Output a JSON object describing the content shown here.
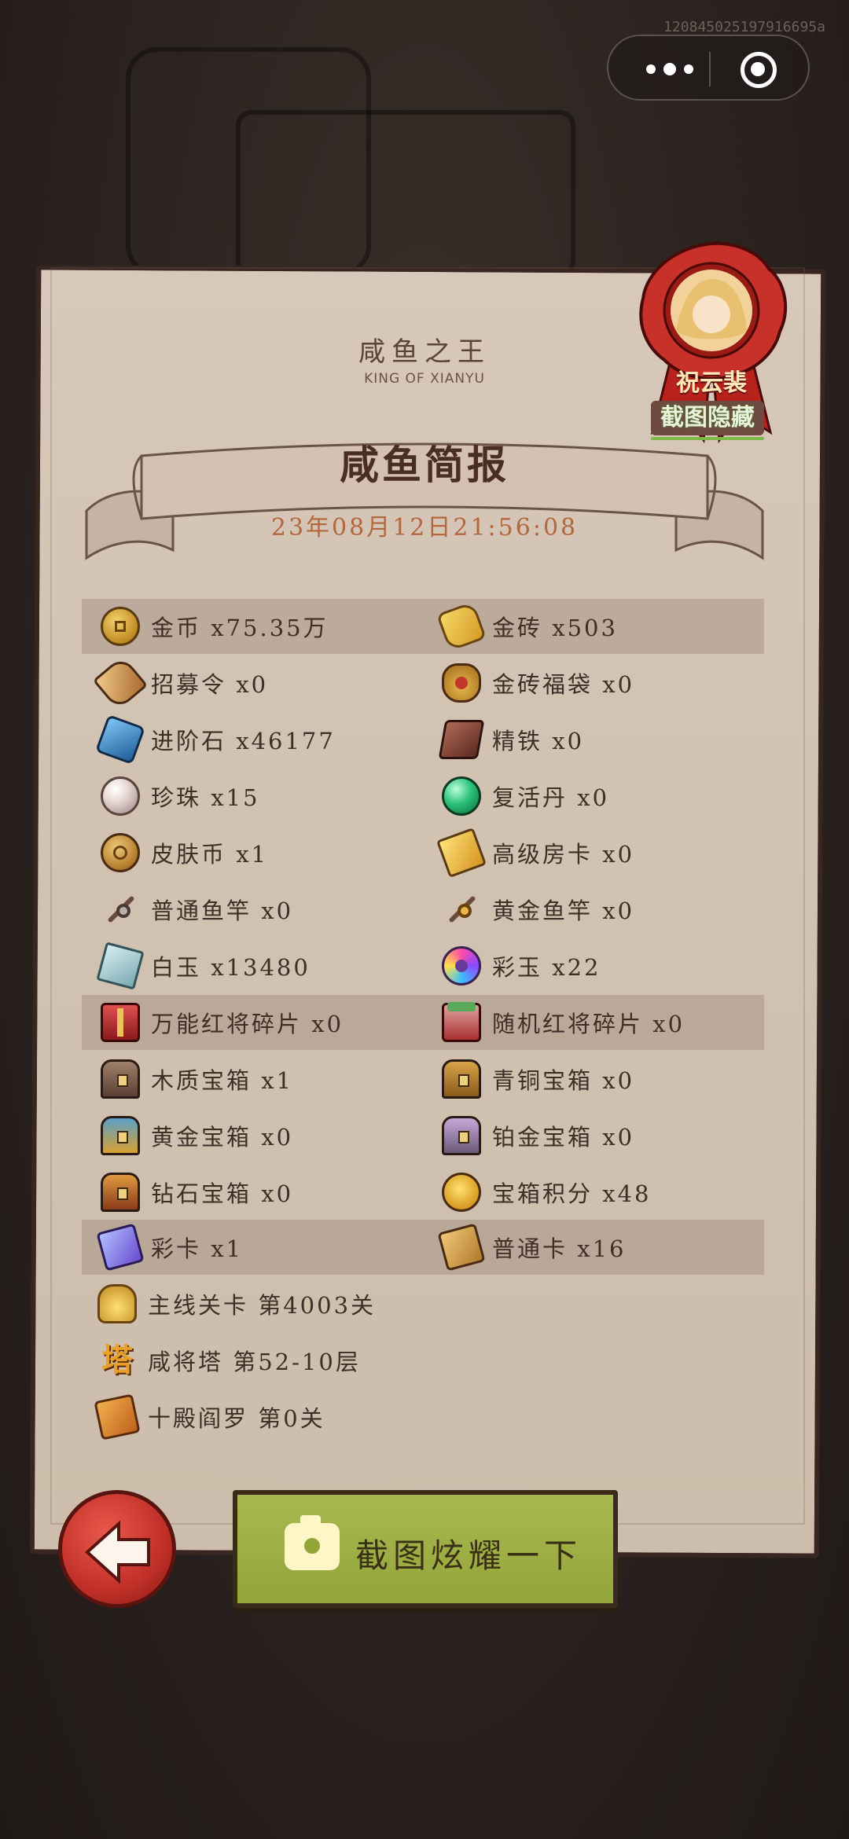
{
  "device_id": "120845025197916695a",
  "header": {
    "title_cn": "咸鱼之王",
    "title_en": "KING OF XIANYU"
  },
  "report": {
    "title": "咸鱼简报",
    "datetime": "23年08月12日21:56:08"
  },
  "seal": {
    "player_name": "祝云裴",
    "hide_label": "截图隐藏"
  },
  "items_left": [
    {
      "icon": "gold-coin-icon",
      "text": "金币 x75.35万"
    },
    {
      "icon": "recruit-token-icon",
      "text": "招募令 x0"
    },
    {
      "icon": "advance-stone-icon",
      "text": "进阶石 x46177"
    },
    {
      "icon": "pearl-icon",
      "text": "珍珠 x15"
    },
    {
      "icon": "skin-coin-icon",
      "text": "皮肤币 x1"
    },
    {
      "icon": "fishing-rod-icon",
      "text": "普通鱼竿 x0"
    },
    {
      "icon": "white-jade-icon",
      "text": "白玉 x13480"
    },
    {
      "icon": "red-general-fragment-icon",
      "text": "万能红将碎片 x0"
    },
    {
      "icon": "wooden-chest-icon",
      "text": "木质宝箱 x1"
    },
    {
      "icon": "golden-chest-icon",
      "text": "黄金宝箱 x0"
    },
    {
      "icon": "diamond-chest-icon",
      "text": "钻石宝箱 x0"
    },
    {
      "icon": "color-card-icon",
      "text": "彩卡 x1"
    }
  ],
  "items_right": [
    {
      "icon": "gold-brick-icon",
      "text": "金砖 x503"
    },
    {
      "icon": "gold-brick-bag-icon",
      "text": "金砖福袋 x0"
    },
    {
      "icon": "refined-iron-icon",
      "text": "精铁 x0"
    },
    {
      "icon": "revive-pill-icon",
      "text": "复活丹 x0"
    },
    {
      "icon": "room-card-icon",
      "text": "高级房卡 x0"
    },
    {
      "icon": "golden-rod-icon",
      "text": "黄金鱼竿 x0"
    },
    {
      "icon": "color-jade-icon",
      "text": "彩玉 x22"
    },
    {
      "icon": "random-fragment-icon",
      "text": "随机红将碎片 x0"
    },
    {
      "icon": "bronze-chest-icon",
      "text": "青铜宝箱 x0"
    },
    {
      "icon": "platinum-chest-icon",
      "text": "铂金宝箱 x0"
    },
    {
      "icon": "chest-points-icon",
      "text": "宝箱积分 x48"
    },
    {
      "icon": "normal-card-icon",
      "text": "普通卡 x16"
    }
  ],
  "progress": [
    {
      "icon": "main-stage-icon",
      "text": "主线关卡 第4003关"
    },
    {
      "icon": "tower-icon",
      "text": "咸将塔 第52-10层",
      "glyph": "塔"
    },
    {
      "icon": "ten-halls-icon",
      "text": "十殿阎罗 第0关"
    }
  ],
  "buttons": {
    "screenshot": "截图炫耀一下"
  }
}
